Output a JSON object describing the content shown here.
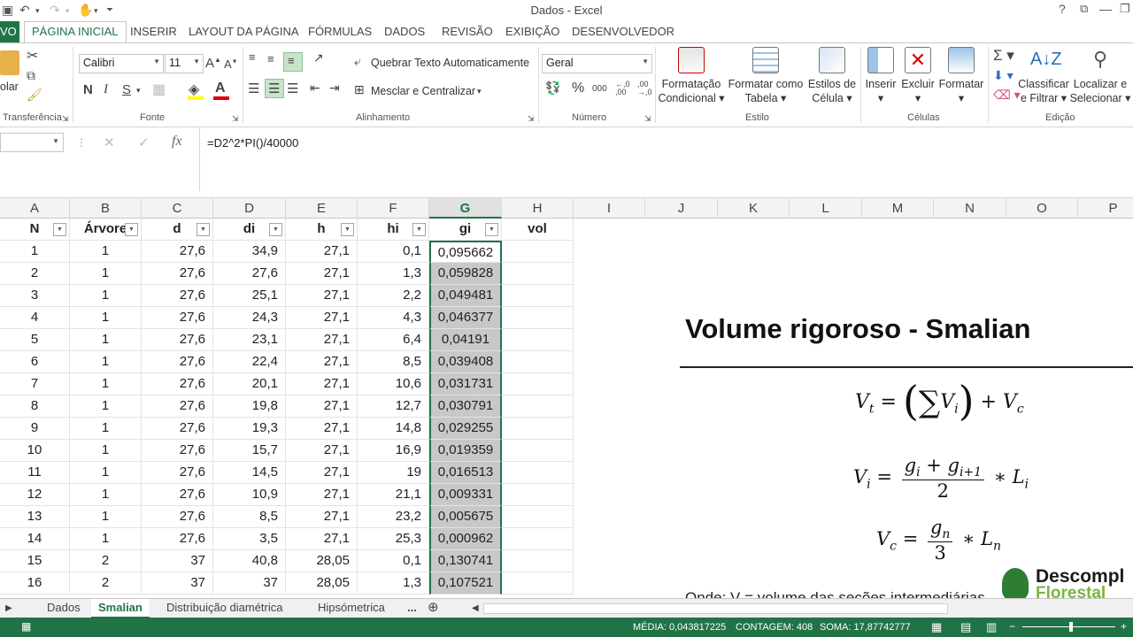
{
  "window": {
    "title": "Dados - Excel"
  },
  "tabs": [
    "VO",
    "PÁGINA INICIAL",
    "INSERIR",
    "LAYOUT DA PÁGINA",
    "FÓRMULAS",
    "DADOS",
    "REVISÃO",
    "EXIBIÇÃO",
    "DESENVOLVEDOR"
  ],
  "ribbon": {
    "clipboard": {
      "paste": "olar",
      "label": "Transferência"
    },
    "font": {
      "name": "Calibri",
      "size": "11",
      "bold": "N",
      "italic": "I",
      "underline": "S",
      "label": "Fonte"
    },
    "alignment": {
      "wrap": "Quebrar Texto Automaticamente",
      "merge": "Mesclar e Centralizar",
      "label": "Alinhamento"
    },
    "number": {
      "format": "Geral",
      "percent": "%",
      "thousands": "000",
      "label": "Número"
    },
    "styles": {
      "conditional": [
        "Formatação",
        "Condicional"
      ],
      "table": [
        "Formatar como",
        "Tabela"
      ],
      "cell": [
        "Estilos de",
        "Célula"
      ],
      "label": "Estilo"
    },
    "cells": {
      "insert": "Inserir",
      "delete": "Excluir",
      "format": "Formatar",
      "label": "Células"
    },
    "editing": {
      "sort": [
        "Classificar",
        "e Filtrar"
      ],
      "find": [
        "Localizar e",
        "Selecionar"
      ],
      "label": "Edição"
    }
  },
  "formula_bar": {
    "formula": "=D2^2*PI()/40000",
    "fx": "fx"
  },
  "columns": [
    "A",
    "B",
    "C",
    "D",
    "E",
    "F",
    "G",
    "H",
    "I",
    "J",
    "K",
    "L",
    "M",
    "N",
    "O",
    "P"
  ],
  "headers": [
    "N",
    "Árvore",
    "d",
    "di",
    "h",
    "hi",
    "gi",
    "vol"
  ],
  "rows": [
    [
      "1",
      "1",
      "27,6",
      "34,9",
      "27,1",
      "0,1",
      "0,095662"
    ],
    [
      "2",
      "1",
      "27,6",
      "27,6",
      "27,1",
      "1,3",
      "0,059828"
    ],
    [
      "3",
      "1",
      "27,6",
      "25,1",
      "27,1",
      "2,2",
      "0,049481"
    ],
    [
      "4",
      "1",
      "27,6",
      "24,3",
      "27,1",
      "4,3",
      "0,046377"
    ],
    [
      "5",
      "1",
      "27,6",
      "23,1",
      "27,1",
      "6,4",
      "0,04191"
    ],
    [
      "6",
      "1",
      "27,6",
      "22,4",
      "27,1",
      "8,5",
      "0,039408"
    ],
    [
      "7",
      "1",
      "27,6",
      "20,1",
      "27,1",
      "10,6",
      "0,031731"
    ],
    [
      "8",
      "1",
      "27,6",
      "19,8",
      "27,1",
      "12,7",
      "0,030791"
    ],
    [
      "9",
      "1",
      "27,6",
      "19,3",
      "27,1",
      "14,8",
      "0,029255"
    ],
    [
      "10",
      "1",
      "27,6",
      "15,7",
      "27,1",
      "16,9",
      "0,019359"
    ],
    [
      "11",
      "1",
      "27,6",
      "14,5",
      "27,1",
      "19",
      "0,016513"
    ],
    [
      "12",
      "1",
      "27,6",
      "10,9",
      "27,1",
      "21,1",
      "0,009331"
    ],
    [
      "13",
      "1",
      "27,6",
      "8,5",
      "27,1",
      "23,2",
      "0,005675"
    ],
    [
      "14",
      "1",
      "27,6",
      "3,5",
      "27,1",
      "25,3",
      "0,000962"
    ],
    [
      "15",
      "2",
      "37",
      "40,8",
      "28,05",
      "0,1",
      "0,130741"
    ],
    [
      "16",
      "2",
      "37",
      "37",
      "28,05",
      "1,3",
      "0,107521"
    ]
  ],
  "panel": {
    "title": "Volume rigoroso - Smalian",
    "footer_text": "Onde: V = volume das seções intermediárias; V = volume",
    "logo": {
      "line1": "Descompl",
      "line2": "Florestal"
    }
  },
  "sheets": [
    "Dados",
    "Smalian",
    "Distribuição diamétrica",
    "Hipsómetrica",
    "..."
  ],
  "status": {
    "media": "MÉDIA: 0,043817225",
    "contagem": "CONTAGEM: 408",
    "soma": "SOMA: 17,87742777"
  },
  "colors": {
    "excel_green": "#217346",
    "selection_gray": "#c8c8c8"
  }
}
